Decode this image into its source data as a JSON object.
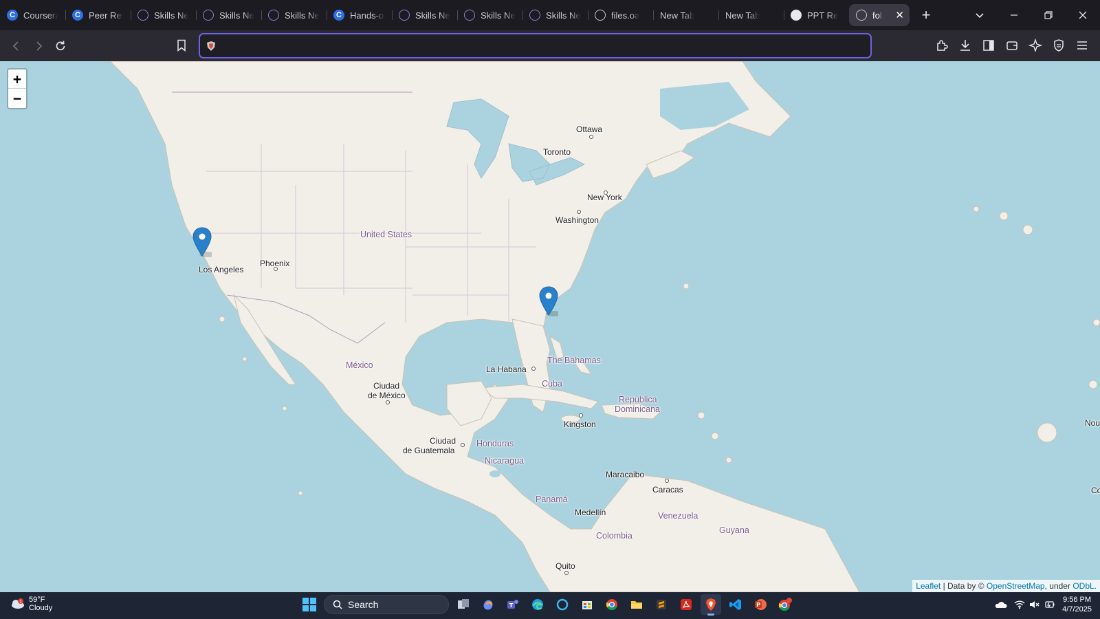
{
  "browser": {
    "tabs": [
      {
        "label": "Coursera",
        "icon": "coursera-icon"
      },
      {
        "label": "Peer Review",
        "icon": "coursera-icon"
      },
      {
        "label": "Skills Network",
        "icon": "skills-network-icon"
      },
      {
        "label": "Skills Network",
        "icon": "skills-network-icon"
      },
      {
        "label": "Skills Network",
        "icon": "skills-network-icon"
      },
      {
        "label": "Hands-on",
        "icon": "coursera-icon"
      },
      {
        "label": "Skills Network",
        "icon": "skills-network-icon"
      },
      {
        "label": "Skills Network",
        "icon": "skills-network-icon"
      },
      {
        "label": "Skills Network",
        "icon": "skills-network-icon"
      },
      {
        "label": "files.oa",
        "icon": "globe-icon"
      },
      {
        "label": "New Tab",
        "icon": ""
      },
      {
        "label": "New Tab",
        "icon": ""
      },
      {
        "label": "PPT Re",
        "icon": "openai-icon"
      },
      {
        "label": "fol",
        "icon": "globe-icon",
        "active": true
      }
    ],
    "url": {
      "value": "",
      "placeholder": ""
    }
  },
  "map": {
    "zoom_in_label": "+",
    "zoom_out_label": "−",
    "labels": {
      "ottawa": "Ottawa",
      "toronto": "Toronto",
      "new_york": "New York",
      "washington": "Washington",
      "united_states": "United States",
      "phoenix": "Phoenix",
      "los_angeles": "Los Angeles",
      "mexico": "México",
      "ciudad_mexico_1": "Ciudad",
      "ciudad_mexico_2": "de México",
      "la_habana": "La Habana",
      "bahamas": "The Bahamas",
      "cuba": "Cuba",
      "republica_1": "República",
      "republica_2": "Dominicana",
      "kingston": "Kingston",
      "guatemala_1": "Ciudad",
      "guatemala_2": "de Guatemala",
      "honduras": "Honduras",
      "nicaragua": "Nicaragua",
      "panama": "Panamá",
      "maracaibo": "Maracaibo",
      "caracas": "Caracas",
      "medellin": "Medellín",
      "venezuela": "Venezuela",
      "colombia": "Colombia",
      "guyana": "Guyana",
      "quito": "Quito",
      "nou": "Nou",
      "co": "Co"
    },
    "markers": [
      {
        "name": "marker-los-angeles"
      },
      {
        "name": "marker-florida"
      }
    ],
    "attribution": {
      "leaflet": "Leaflet",
      "sep": " | Data by © ",
      "osm": "OpenStreetMap",
      "under": ", under ",
      "odbl": "ODbL."
    }
  },
  "taskbar": {
    "weather_temp": "59°F",
    "weather_desc": "Cloudy",
    "weather_badge": "1",
    "search_label": "Search",
    "time": "9:56 PM",
    "date": "4/7/2025"
  }
}
